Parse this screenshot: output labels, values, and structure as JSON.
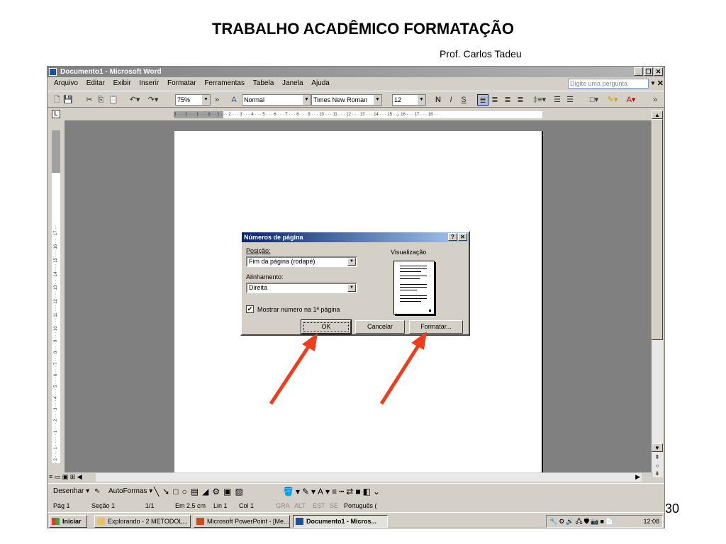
{
  "slide": {
    "title": "TRABALHO ACADÊMICO FORMATAÇÃO",
    "subtitle": "Prof. Carlos Tadeu",
    "number": "30"
  },
  "window": {
    "title": "Documento1 - Microsoft Word",
    "minimize": "_",
    "restore": "❐",
    "close": "✕"
  },
  "menu": {
    "items": [
      "Arquivo",
      "Editar",
      "Exibir",
      "Inserir",
      "Formatar",
      "Ferramentas",
      "Tabela",
      "Janela",
      "Ajuda"
    ],
    "help_placeholder": "Digite uma pergunta",
    "close_doc": "✕"
  },
  "toolbar": {
    "zoom": "75%",
    "style": "Normal",
    "font": "Times New Roman",
    "size": "12",
    "bold": "N",
    "italic": "I",
    "underline": "S"
  },
  "ruler": {
    "horizontal_text": "3 · · · 2 · · · 1 · · · ⧖ · · 1 · · · 2 · · · 3 · · · 4 · · · 5 · · · 6 · · · 7 · · · 8 · · · 9 · · · 10 · · · 11 · · · 12 · · · 13 · · · 14 · · · 15 · △ 16 · · · 17 · · · 18 · ·",
    "vertical_text": "· 2 · · · 1 · · · · · 1 · · · 2 · · · 3 · · · 4 · · · 5 · · · 6 · · · 7 · · · 8 · · · 9 · · · 10 · · · 11 · · · 12 · · · 13 · · · 14 · · · 15 · · · 16 · · · 17 · ·"
  },
  "dialog": {
    "title": "Números de página",
    "help": "?",
    "close": "✕",
    "position_label": "Posição:",
    "position_value": "Fim da página (rodapé)",
    "align_label": "Alinhamento:",
    "align_value": "Direita",
    "preview_label": "Visualização",
    "checkbox_label": "Mostrar número na 1ª página",
    "checkbox_mark": "✔",
    "ok": "OK",
    "cancel": "Cancelar",
    "format": "Formatar..."
  },
  "drawbar": {
    "draw": "Desenhar ▾",
    "autoshapes": "AutoFormas ▾"
  },
  "status": {
    "page": "Pág 1",
    "section": "Seção 1",
    "pages": "1/1",
    "at": "Em 2,5 cm",
    "line": "Lin 1",
    "col": "Col 1",
    "rec": "GRA",
    "trk": "ALT",
    "ext": "EST",
    "ovr": "SE",
    "lang": "Português ("
  },
  "taskbar": {
    "start": "Iniciar",
    "tasks": [
      "Explorando - 2 METODOL...",
      "Microsoft PowerPoint - [Me...",
      "Documento1 - Micros..."
    ],
    "clock": "12:08"
  },
  "colors": {
    "arrow": "#ef3d1c",
    "dialog_title": "#0a246a"
  }
}
